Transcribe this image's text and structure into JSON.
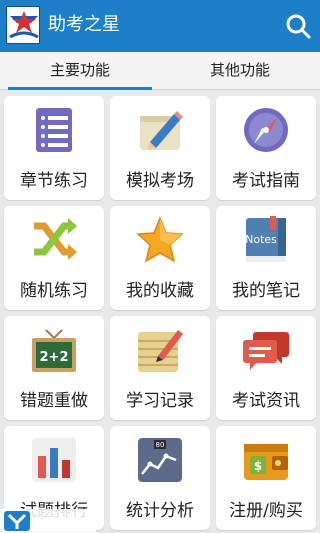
{
  "app": {
    "title": "助考之星"
  },
  "tabs": [
    {
      "label": "主要功能",
      "active": true
    },
    {
      "label": "其他功能",
      "active": false
    }
  ],
  "tiles": [
    {
      "label": "章节练习",
      "icon": "document-list-icon"
    },
    {
      "label": "模拟考场",
      "icon": "pencil-paper-icon"
    },
    {
      "label": "考试指南",
      "icon": "compass-icon"
    },
    {
      "label": "随机练习",
      "icon": "shuffle-icon"
    },
    {
      "label": "我的收藏",
      "icon": "star-icon"
    },
    {
      "label": "我的笔记",
      "icon": "notebook-icon",
      "icon_text": "Notes"
    },
    {
      "label": "错题重做",
      "icon": "chalkboard-icon",
      "icon_text": "2+2"
    },
    {
      "label": "学习记录",
      "icon": "notepad-pencil-icon"
    },
    {
      "label": "考试资讯",
      "icon": "chat-bubbles-icon"
    },
    {
      "label": "试题排行",
      "icon": "bar-chart-icon"
    },
    {
      "label": "统计分析",
      "icon": "line-chart-icon",
      "icon_text": "80"
    },
    {
      "label": "注册/购买",
      "icon": "wallet-icon",
      "icon_text": "$"
    }
  ],
  "colors": {
    "appbar": "#1d7fc8",
    "tile": "#ffffff",
    "background": "#e9e9e9"
  }
}
